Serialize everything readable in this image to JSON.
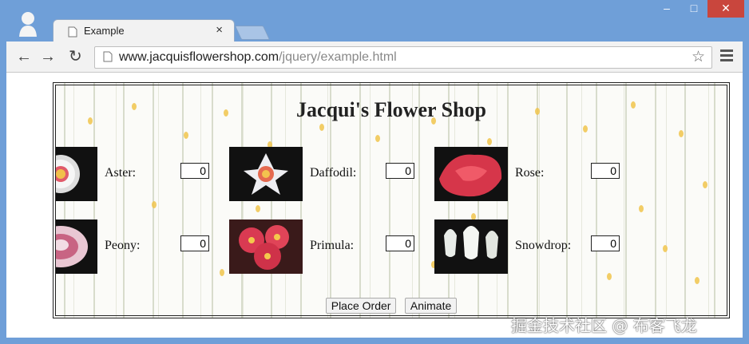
{
  "window": {
    "tab_title": "Example",
    "tab_close": "×",
    "min_label": "–",
    "max_label": "□",
    "close_label": "✕"
  },
  "toolbar": {
    "back": "←",
    "forward": "→",
    "reload": "↻",
    "url_host": "www.jacquisflowershop.com",
    "url_path": "/jquery/example.html",
    "star": "☆"
  },
  "page": {
    "title": "Jacqui's Flower Shop",
    "products": [
      {
        "name": "Aster:",
        "qty": "0",
        "icon": "aster-image"
      },
      {
        "name": "Daffodil:",
        "qty": "0",
        "icon": "daffodil-image"
      },
      {
        "name": "Rose:",
        "qty": "0",
        "icon": "rose-image"
      },
      {
        "name": "Peony:",
        "qty": "0",
        "icon": "peony-image"
      },
      {
        "name": "Primula:",
        "qty": "0",
        "icon": "primula-image"
      },
      {
        "name": "Snowdrop:",
        "qty": "0",
        "icon": "snowdrop-image"
      }
    ],
    "place_order": "Place Order",
    "animate": "Animate"
  },
  "watermark": "掘金技术社区 @ 布客飞龙"
}
